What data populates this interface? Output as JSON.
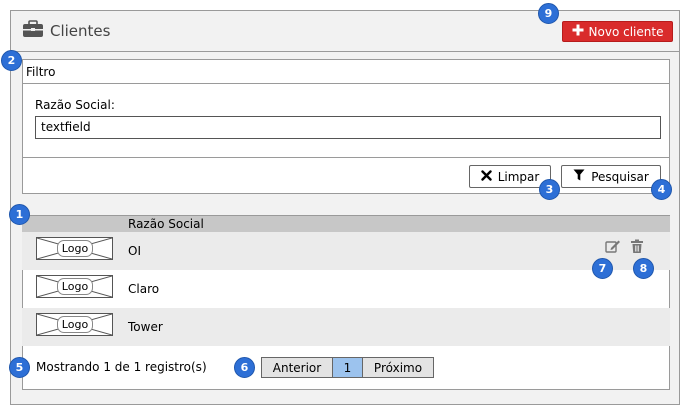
{
  "header": {
    "title": "Clientes",
    "icon": "briefcase-icon",
    "new_button_label": "Novo cliente",
    "new_button_icon": "plus-icon",
    "accent": "#d92b2b"
  },
  "filter": {
    "title": "Filtro",
    "field_label": "Razão Social:",
    "field_value": "textfield",
    "clear_label": "Limpar",
    "clear_icon": "x-icon",
    "search_label": "Pesquisar",
    "search_icon": "funnel-icon"
  },
  "table": {
    "column_header": "Razão Social",
    "rows": [
      {
        "logo": "Logo",
        "name": "OI"
      },
      {
        "logo": "Logo",
        "name": "Claro"
      },
      {
        "logo": "Logo",
        "name": "Tower"
      }
    ],
    "edit_icon": "edit-icon",
    "delete_icon": "trash-icon"
  },
  "footer": {
    "showing": "Mostrando 1 de 1 registro(s)",
    "pagination": {
      "prev": "Anterior",
      "current": "1",
      "next": "Próximo"
    }
  },
  "badges": {
    "b1": "1",
    "b2": "2",
    "b3": "3",
    "b4": "4",
    "b5": "5",
    "b6": "6",
    "b7": "7",
    "b8": "8",
    "b9": "9",
    "color": "#2d6fd6"
  }
}
